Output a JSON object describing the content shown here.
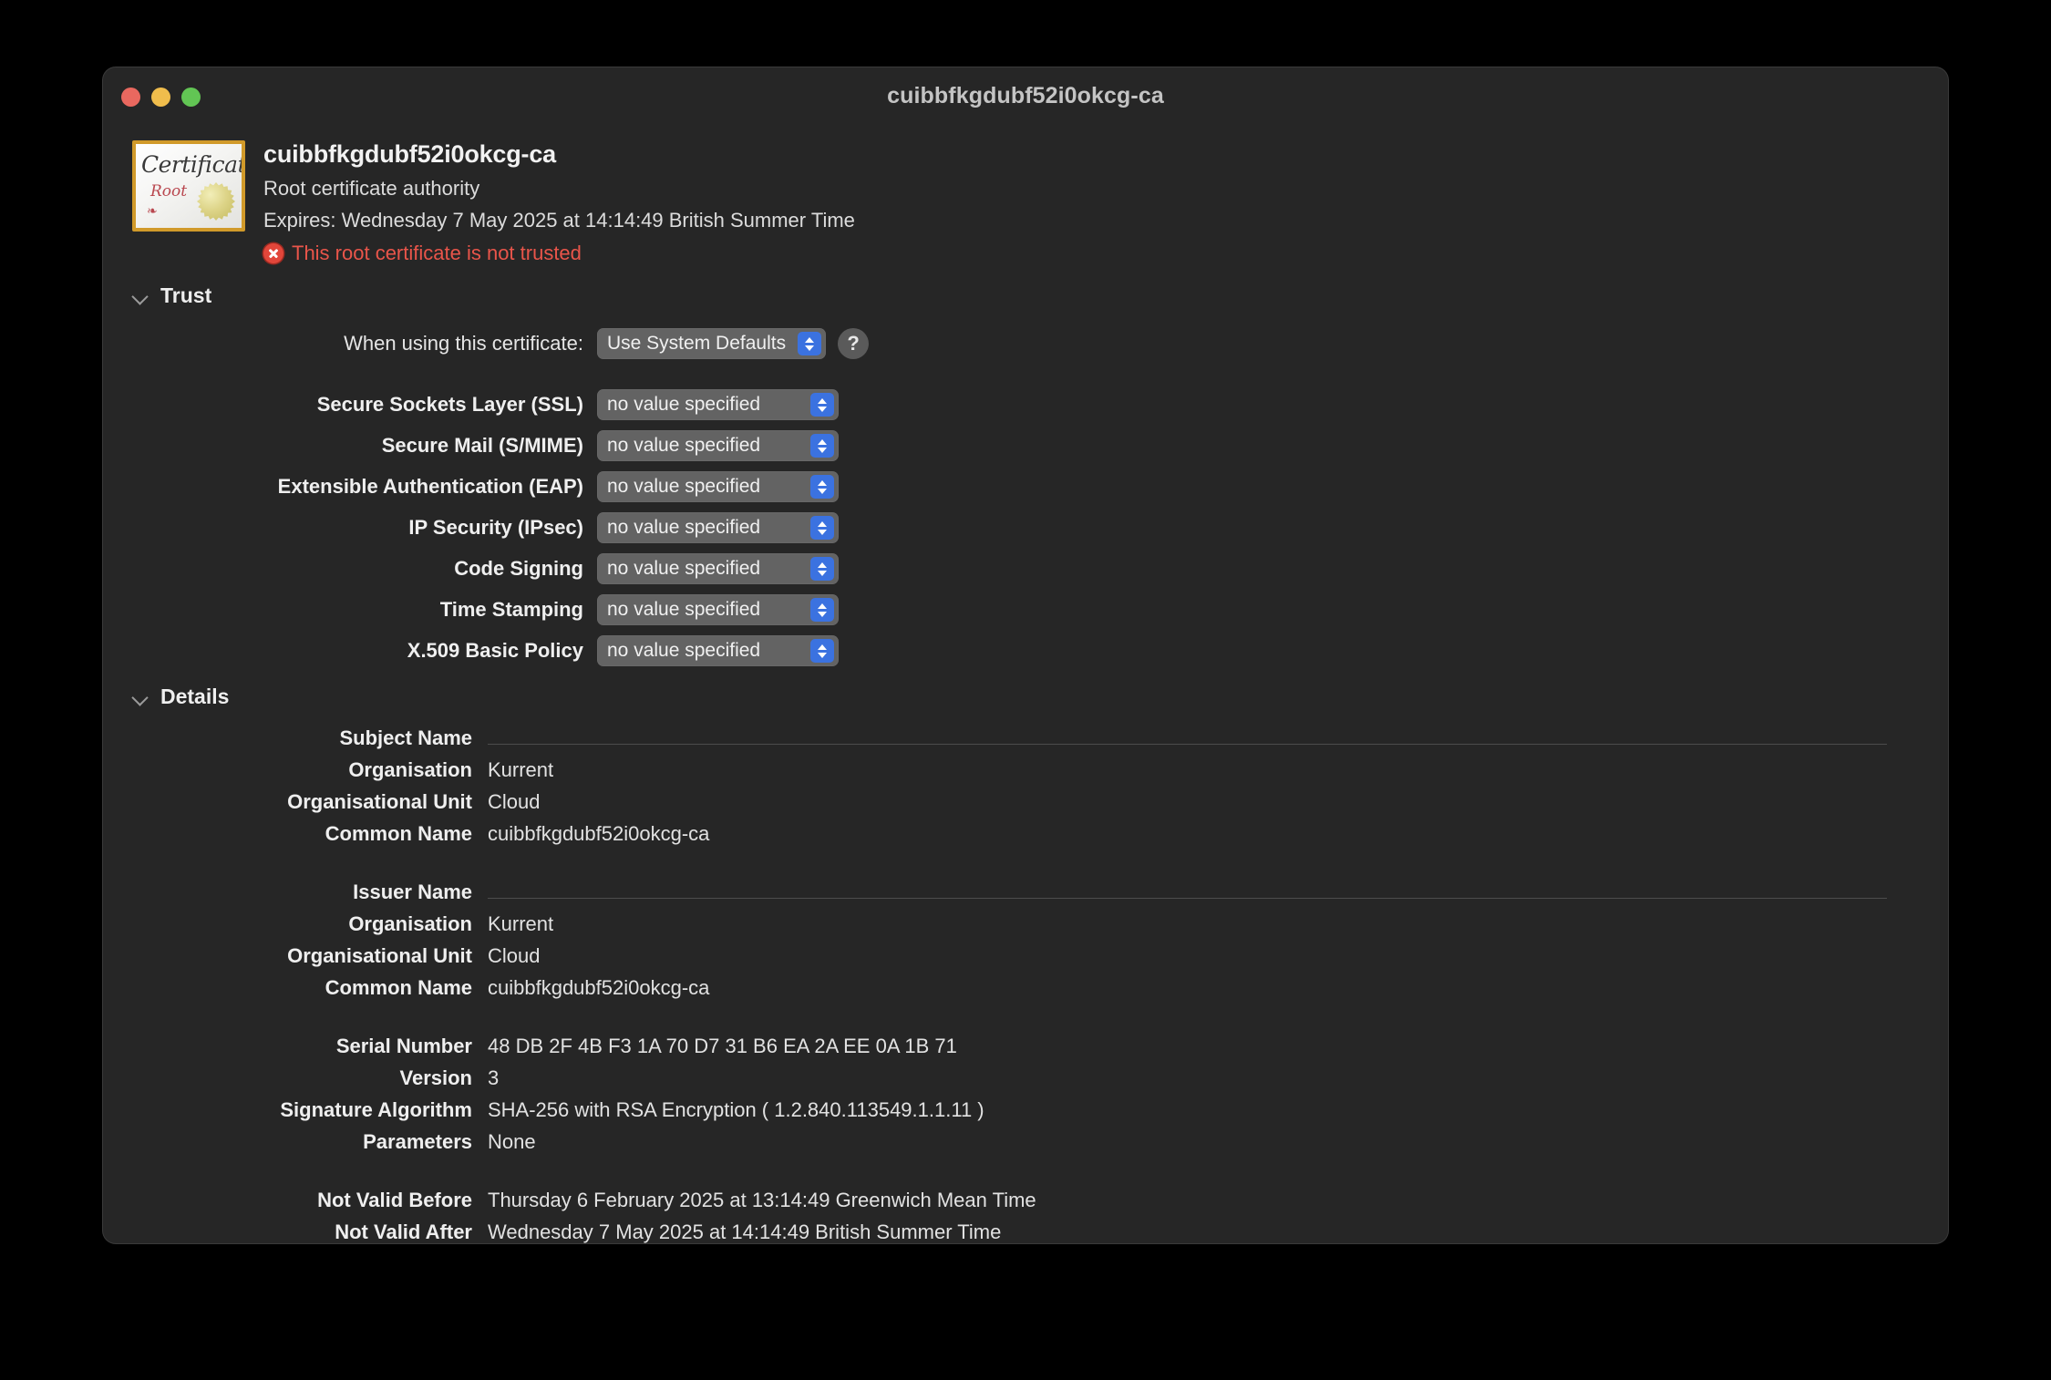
{
  "window": {
    "title": "cuibbfkgdubf52i0okcg-ca",
    "traffic_lights": {
      "close": "close-window",
      "minimize": "minimize-window",
      "zoom": "zoom-window"
    }
  },
  "header": {
    "icon_name": "root-certificate-icon",
    "icon_text": {
      "certificate": "Certificate",
      "root": "Root",
      "flourish": "❧"
    },
    "name": "cuibbfkgdubf52i0okcg-ca",
    "kind": "Root certificate authority",
    "expires": "Expires: Wednesday 7 May 2025 at 14:14:49 British Summer Time",
    "warning": "This root certificate is not trusted",
    "warning_color": "#e9554a"
  },
  "trust": {
    "section_label": "Trust",
    "using_label": "When using this certificate:",
    "using_value": "Use System Defaults",
    "help_label": "?",
    "rows": [
      {
        "label": "Secure Sockets Layer (SSL)",
        "value": "no value specified"
      },
      {
        "label": "Secure Mail (S/MIME)",
        "value": "no value specified"
      },
      {
        "label": "Extensible Authentication (EAP)",
        "value": "no value specified"
      },
      {
        "label": "IP Security (IPsec)",
        "value": "no value specified"
      },
      {
        "label": "Code Signing",
        "value": "no value specified"
      },
      {
        "label": "Time Stamping",
        "value": "no value specified"
      },
      {
        "label": "X.509 Basic Policy",
        "value": "no value specified"
      }
    ]
  },
  "details": {
    "section_label": "Details",
    "groups": [
      {
        "heading": "Subject Name",
        "rows": [
          {
            "label": "Organisation",
            "value": "Kurrent"
          },
          {
            "label": "Organisational Unit",
            "value": "Cloud"
          },
          {
            "label": "Common Name",
            "value": "cuibbfkgdubf52i0okcg-ca"
          }
        ]
      },
      {
        "heading": "Issuer Name",
        "rows": [
          {
            "label": "Organisation",
            "value": "Kurrent"
          },
          {
            "label": "Organisational Unit",
            "value": "Cloud"
          },
          {
            "label": "Common Name",
            "value": "cuibbfkgdubf52i0okcg-ca"
          }
        ]
      },
      {
        "heading": null,
        "rows": [
          {
            "label": "Serial Number",
            "value": "48 DB 2F 4B F3 1A 70 D7 31 B6 EA 2A EE 0A 1B 71"
          },
          {
            "label": "Version",
            "value": "3"
          },
          {
            "label": "Signature Algorithm",
            "value": "SHA-256 with RSA Encryption ( 1.2.840.113549.1.1.11 )"
          },
          {
            "label": "Parameters",
            "value": "None"
          }
        ]
      },
      {
        "heading": null,
        "rows": [
          {
            "label": "Not Valid Before",
            "value": "Thursday 6 February 2025 at 13:14:49 Greenwich Mean Time"
          },
          {
            "label": "Not Valid After",
            "value": "Wednesday 7 May 2025 at 14:14:49 British Summer Time"
          }
        ]
      }
    ]
  }
}
